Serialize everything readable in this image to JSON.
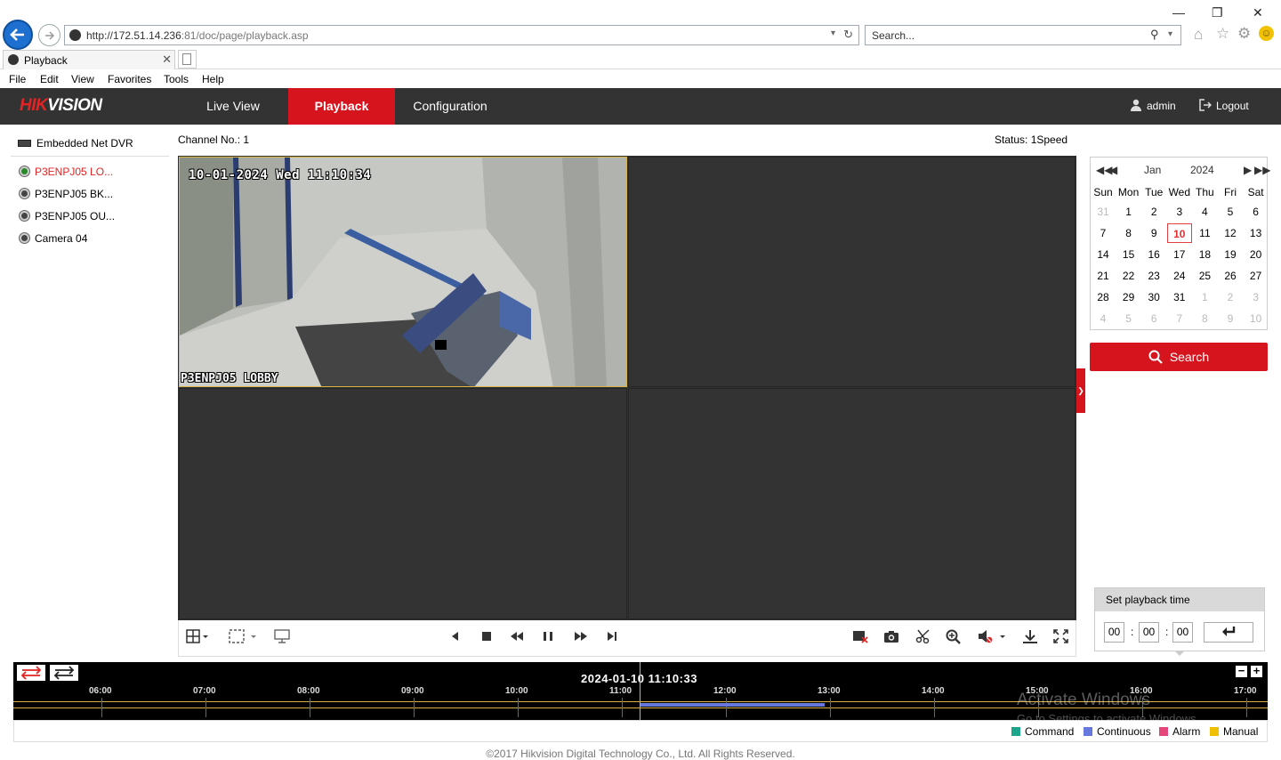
{
  "browser": {
    "url_prefix": "http://",
    "url_host": "172.51.14.236",
    "url_rest": ":81/doc/page/playback.asp",
    "search_placeholder": "Search...",
    "tab_title": "Playback",
    "menu": [
      "File",
      "Edit",
      "View",
      "Favorites",
      "Tools",
      "Help"
    ]
  },
  "app": {
    "logo_red": "HIK",
    "logo_white": "VISION",
    "nav": [
      "Live View",
      "Playback",
      "Configuration"
    ],
    "user": "admin",
    "logout": "Logout"
  },
  "tree": {
    "device": "Embedded Net DVR",
    "cameras": [
      "P3ENPJ05 LO...",
      "P3ENPJ05 BK...",
      "P3ENPJ05 OU...",
      "Camera 04"
    ]
  },
  "channel_label": "Channel No.: 1",
  "status_label": "Status: 1Speed",
  "video": {
    "osd_time": "10-01-2024 Wed 11:10:34",
    "osd_name": "P3ENPJ05 LOBBY"
  },
  "calendar": {
    "month": "Jan",
    "year": "2024",
    "weekdays": [
      "Sun",
      "Mon",
      "Tue",
      "Wed",
      "Thu",
      "Fri",
      "Sat"
    ],
    "weeks": [
      [
        "31",
        "1",
        "2",
        "3",
        "4",
        "5",
        "6"
      ],
      [
        "7",
        "8",
        "9",
        "10",
        "11",
        "12",
        "13"
      ],
      [
        "14",
        "15",
        "16",
        "17",
        "18",
        "19",
        "20"
      ],
      [
        "21",
        "22",
        "23",
        "24",
        "25",
        "26",
        "27"
      ],
      [
        "28",
        "29",
        "30",
        "31",
        "1",
        "2",
        "3"
      ],
      [
        "4",
        "5",
        "6",
        "7",
        "8",
        "9",
        "10"
      ]
    ],
    "selected_day": "10",
    "recorded_days": [
      "1",
      "2",
      "3",
      "4",
      "5",
      "6",
      "7",
      "10"
    ],
    "accent": "#2d8ed8"
  },
  "search_label": "Search",
  "set_playback": {
    "title": "Set playback time",
    "hh": "00",
    "mm": "00",
    "ss": "00"
  },
  "timeline": {
    "current": "2024-01-10 11:10:33",
    "hours": [
      "06:00",
      "07:00",
      "08:00",
      "09:00",
      "10:00",
      "11:00",
      "12:00",
      "13:00",
      "14:00",
      "15:00",
      "16:00",
      "17:00"
    ],
    "segment_start": "11:10",
    "segment_end": "13:00"
  },
  "legend": [
    {
      "label": "Command",
      "color": "#1aa58c"
    },
    {
      "label": "Continuous",
      "color": "#6677dd"
    },
    {
      "label": "Alarm",
      "color": "#e6457a"
    },
    {
      "label": "Manual",
      "color": "#f0c000"
    }
  ],
  "watermark": {
    "line1": "Activate Windows",
    "line2": "Go to Settings to activate Windows."
  },
  "copyright": "©2017 Hikvision Digital Technology Co., Ltd. All Rights Reserved.",
  "colors": {
    "brand": "#d6141e",
    "header": "#333333"
  }
}
